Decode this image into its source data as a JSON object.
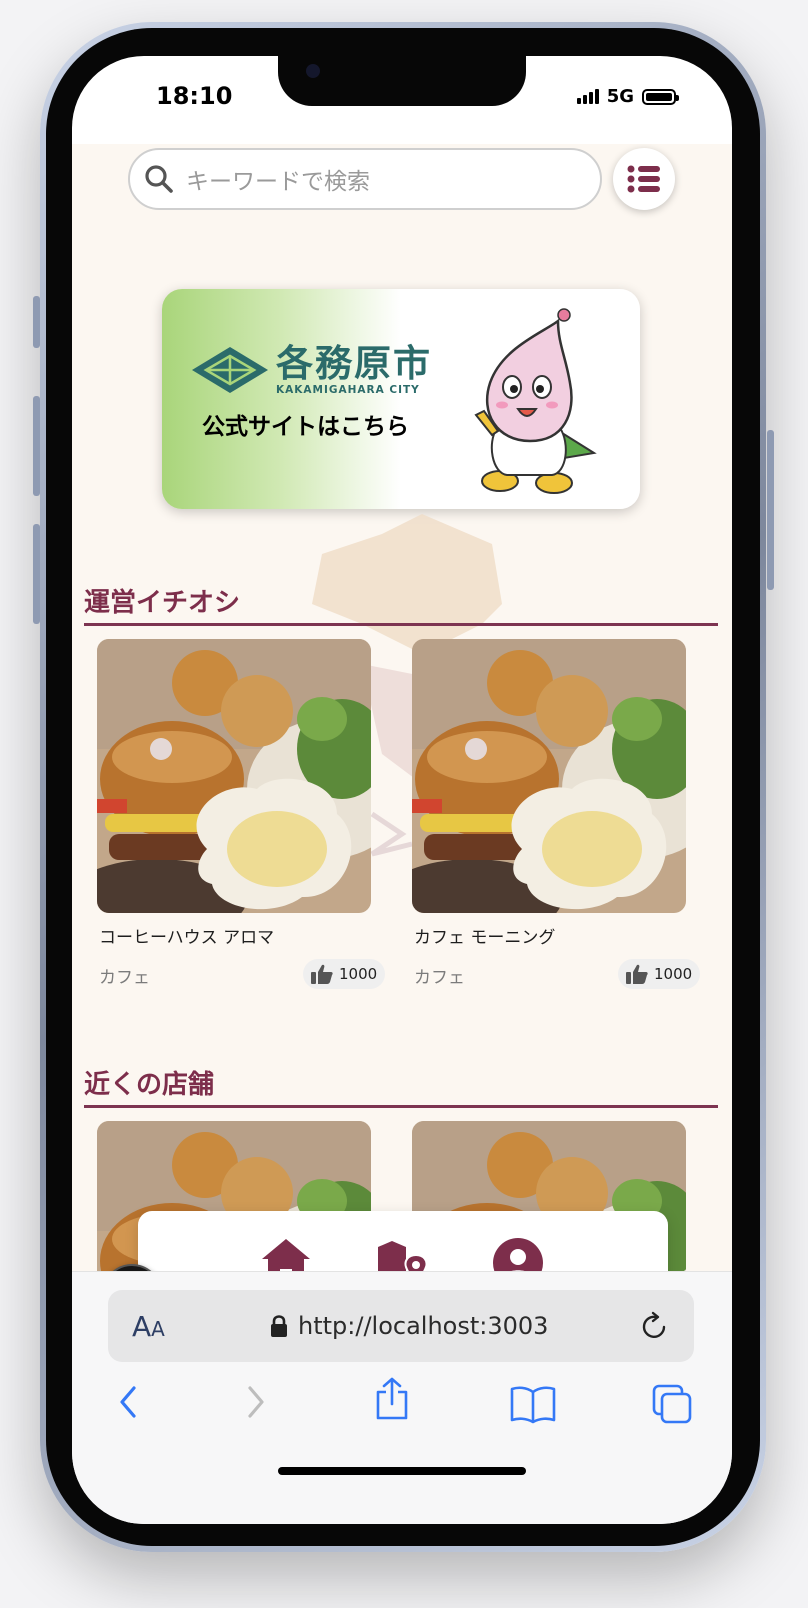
{
  "status": {
    "time": "18:10",
    "network": "5G"
  },
  "search": {
    "placeholder": "キーワードで検索"
  },
  "banner": {
    "logo_text": "各務原市",
    "logo_subtext": "KAKAMIGAHARA CITY",
    "cta": "公式サイトはこちら"
  },
  "sections": {
    "featured": {
      "title": "運営イチオシ",
      "cards": [
        {
          "name": "コーヒーハウス アロマ",
          "category": "カフェ",
          "likes": "1000"
        },
        {
          "name": "カフェ モーニング",
          "category": "カフェ",
          "likes": "1000"
        }
      ]
    },
    "nearby": {
      "title": "近くの店舗"
    }
  },
  "bottom_nav": {
    "items": [
      "home-icon",
      "map-icon",
      "user-icon"
    ],
    "active": "home-icon"
  },
  "next_badge": "N",
  "browser": {
    "aa_large": "A",
    "aa_small": "A",
    "url": "http://localhost:3003"
  },
  "colors": {
    "accent": "#7d2e4b",
    "background": "#fcf7f1",
    "banner_green": "#a9d57a",
    "ios_blue": "#3478f6"
  }
}
